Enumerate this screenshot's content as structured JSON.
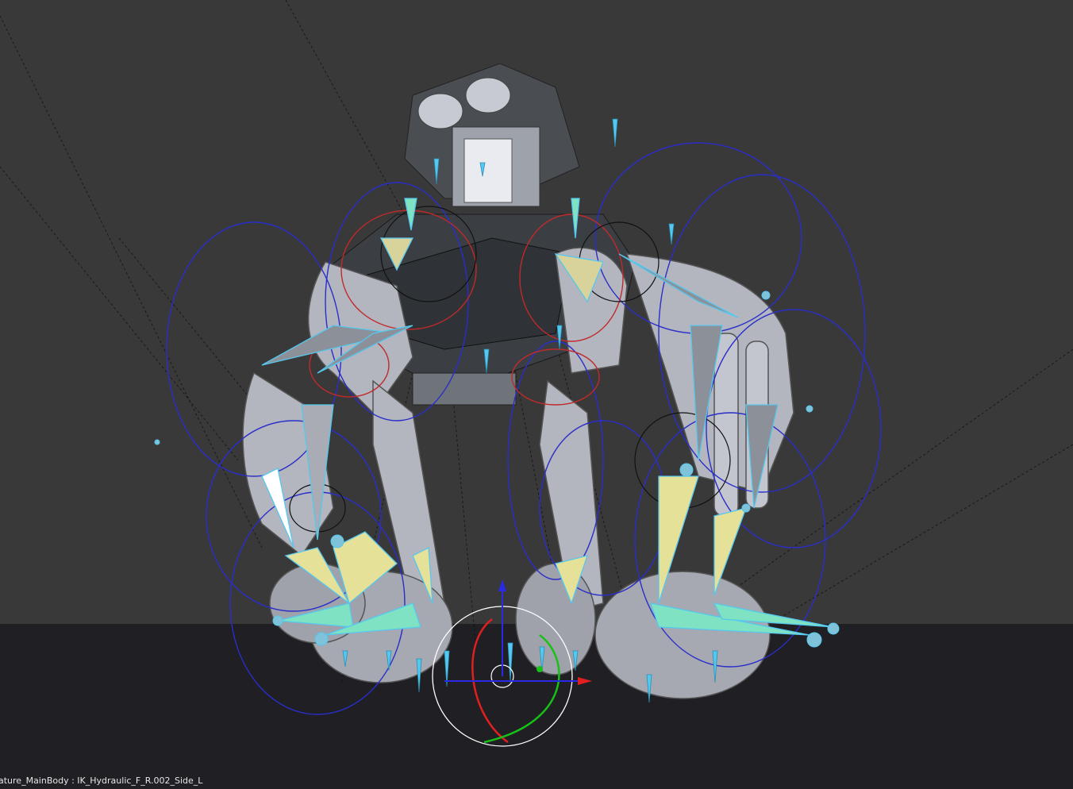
{
  "viewport": {
    "status_line": "ature_MainBody : IK_Hydraulic_F_R.002_Side_L",
    "colors": {
      "background": "#393939",
      "floor": "#1f1f24",
      "mesh": "#b9bcc6",
      "mesh_dark": "#5b5f66",
      "bone_blue": "#56c7ee",
      "bone_yellow": "#e6e198",
      "bone_green": "#7fe3c3",
      "control_circle": "#2a2ec9",
      "ik_circle_red": "#c02a2a",
      "gizmo_x": "#e02020",
      "gizmo_y": "#18c018",
      "gizmo_z": "#2a2ae6",
      "gizmo_view": "#ffffff"
    },
    "icons": [
      "transform-gizmo-icon",
      "cursor-icon"
    ]
  }
}
